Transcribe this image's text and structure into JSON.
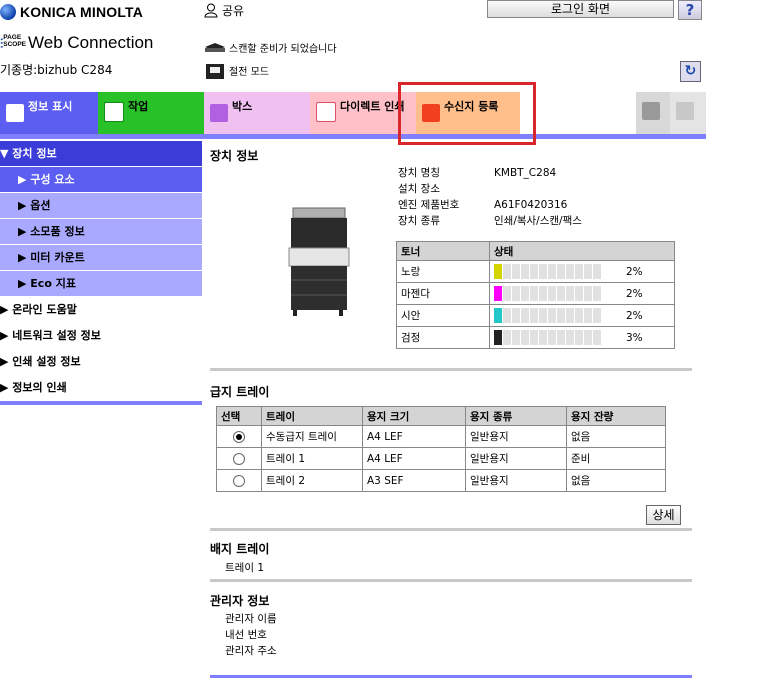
{
  "header": {
    "brand": "KONICA MINOLTA",
    "pagescope_badge": "PAGE\nSCOPE",
    "product": "Web Connection",
    "model": "기종명:bizhub C284",
    "user_mode": "공유",
    "status_scan": "스캔할 준비가 되었습니다",
    "status_power": "절전 모드",
    "login_button": "로그인 화면",
    "help_button": "?"
  },
  "tabs": [
    {
      "label": "정보 표시",
      "color": "#5b5ef0",
      "icon": "info-icon"
    },
    {
      "label": "작업",
      "color": "#28c228",
      "icon": "job-icon"
    },
    {
      "label": "박스",
      "color": "#f0c0f0",
      "icon": "box-icon"
    },
    {
      "label": "다이렉트 인쇄",
      "color": "#ffc0c8",
      "icon": "print-icon"
    },
    {
      "label": "수신지 등록",
      "color": "#ffbe8a",
      "icon": "address-icon"
    }
  ],
  "sidebar": {
    "items": [
      {
        "label": "▼ 장치 정보"
      },
      {
        "label": "▶ 구성 요소"
      },
      {
        "label": "▶ 옵션"
      },
      {
        "label": "▶ 소모품 정보"
      },
      {
        "label": "▶ 미터 카운트"
      },
      {
        "label": "▶ Eco 지표"
      },
      {
        "label": "▶ 온라인 도움말"
      },
      {
        "label": "▶ 네트워크 설정 정보"
      },
      {
        "label": "▶ 인쇄 설정 정보"
      },
      {
        "label": "▶ 정보의 인쇄"
      }
    ]
  },
  "device": {
    "title": "장치 정보",
    "fields": [
      {
        "label": "장치 명칭",
        "value": "KMBT_C284"
      },
      {
        "label": "설치 장소",
        "value": ""
      },
      {
        "label": "엔진 제품번호",
        "value": "A61F0420316"
      },
      {
        "label": "장치 종류",
        "value": "인쇄/복사/스캔/팩스"
      }
    ]
  },
  "toner": {
    "headers": [
      "토너",
      "상태"
    ],
    "rows": [
      {
        "name": "노랑",
        "percent": "2%",
        "level": 0.02,
        "color": "#d4d400"
      },
      {
        "name": "마젠다",
        "percent": "2%",
        "level": 0.02,
        "color": "#ff00ff"
      },
      {
        "name": "시안",
        "percent": "2%",
        "level": 0.02,
        "color": "#22c8c8"
      },
      {
        "name": "검정",
        "percent": "3%",
        "level": 0.03,
        "color": "#222222"
      }
    ]
  },
  "paper_tray": {
    "title": "급지 트레이",
    "headers": [
      "선택",
      "트레이",
      "용지 크기",
      "용지 종류",
      "용지 잔량"
    ],
    "rows": [
      {
        "selected": true,
        "tray": "수동급지 트레이",
        "size": "A4 LEF",
        "type": "일반용지",
        "remain": "없음"
      },
      {
        "selected": false,
        "tray": "트레이 1",
        "size": "A4 LEF",
        "type": "일반용지",
        "remain": "준비"
      },
      {
        "selected": false,
        "tray": "트레이 2",
        "size": "A3 SEF",
        "type": "일반용지",
        "remain": "없음"
      }
    ],
    "detail_button": "상세"
  },
  "output_tray": {
    "title": "배지 트레이",
    "items": [
      "트레이 1"
    ]
  },
  "admin": {
    "title": "관리자 정보",
    "items": [
      "관리자 이름",
      "내선 번호",
      "관리자 주소"
    ]
  }
}
